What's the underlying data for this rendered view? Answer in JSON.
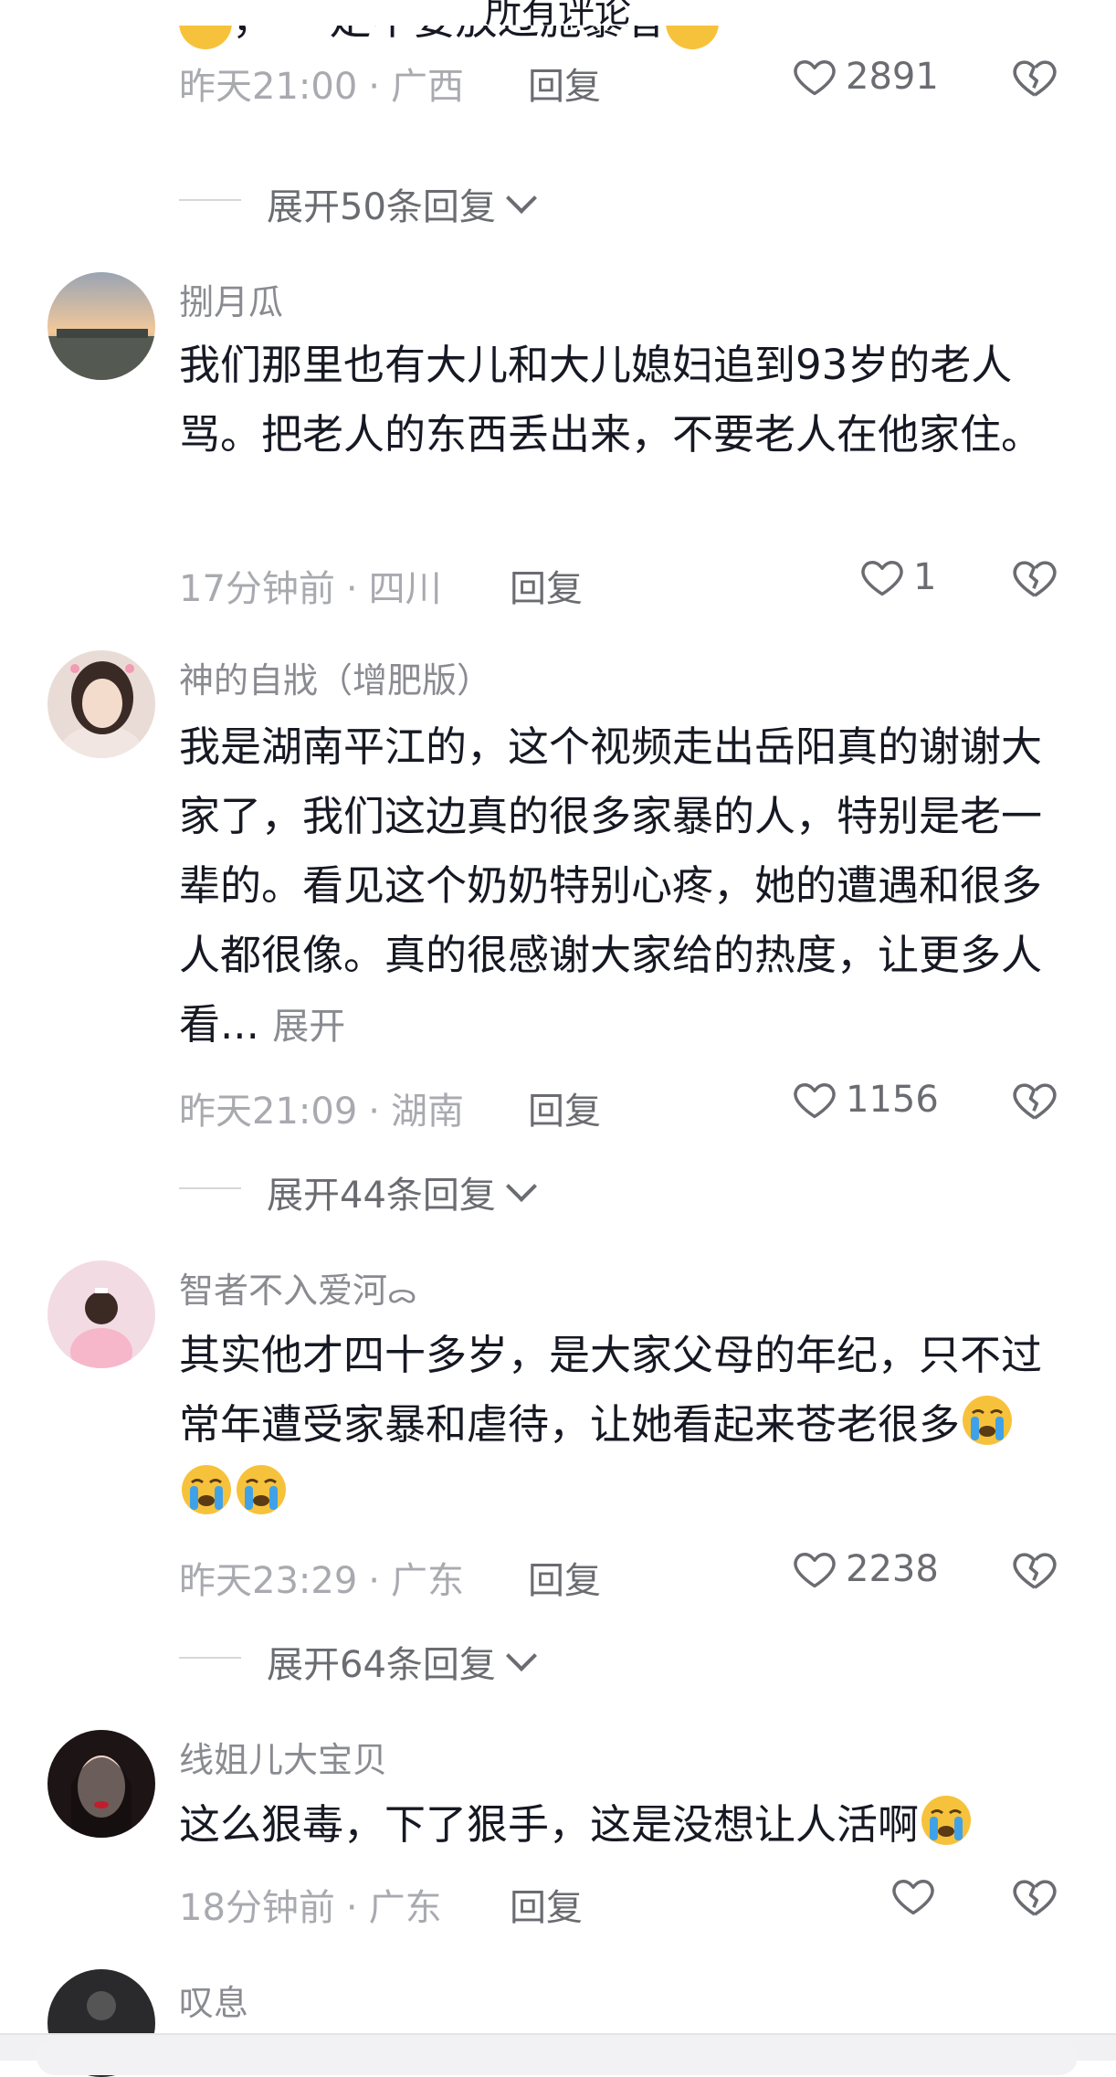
{
  "header": {
    "title": "所有评论"
  },
  "comments": [
    {
      "id": "c0",
      "partial_text": "，   一定不要放过施暴者",
      "time": "昨天21:00",
      "location": "广西",
      "reply_label": "回复",
      "likes": "2891",
      "expand_label": "展开50条回复"
    },
    {
      "id": "c1",
      "username": "捌月瓜",
      "text": "我们那里也有大儿和大儿媳妇追到93岁的老人骂。把老人的东西丢出来，不要老人在他家住。",
      "time": "17分钟前",
      "location": "四川",
      "reply_label": "回复",
      "likes": "1"
    },
    {
      "id": "c2",
      "username": "神的自戕（增肥版）",
      "text": "我是湖南平江的，这个视频走出岳阳真的谢谢大家了，我们这边真的很多家暴的人，特别是老一辈的。看见这个奶奶特别心疼，她的遭遇和很多人都很像。真的很感谢大家给的热度，让更多人看...",
      "more_label": "展开",
      "time": "昨天21:09",
      "location": "湖南",
      "reply_label": "回复",
      "likes": "1156",
      "expand_label": "展开44条回复"
    },
    {
      "id": "c3",
      "username": "智者不入爱河",
      "username_suffix": "ᯅ",
      "text": "其实他才四十多岁，是大家父母的年纪，只不过常年遭受家暴和虐待，让她看起来苍老很多",
      "time": "昨天23:29",
      "location": "广东",
      "reply_label": "回复",
      "likes": "2238",
      "expand_label": "展开64条回复"
    },
    {
      "id": "c4",
      "username": "线姐儿大宝贝",
      "text": "这么狠毒，下了狠手，这是没想让人活啊",
      "time": "18分钟前",
      "location": "广东",
      "reply_label": "回复",
      "likes": ""
    },
    {
      "id": "c5",
      "username": "叹息"
    }
  ],
  "icons": {
    "like": "heart-outline-icon",
    "dislike": "broken-heart-icon",
    "expand": "chevron-down-icon",
    "emoji": "loudly-crying-face-emoji"
  },
  "colors": {
    "text_primary": "#161823",
    "text_secondary": "#8a8b91",
    "emoji_yellow": "#f7c23b",
    "tear_blue": "#3fa2e8"
  }
}
